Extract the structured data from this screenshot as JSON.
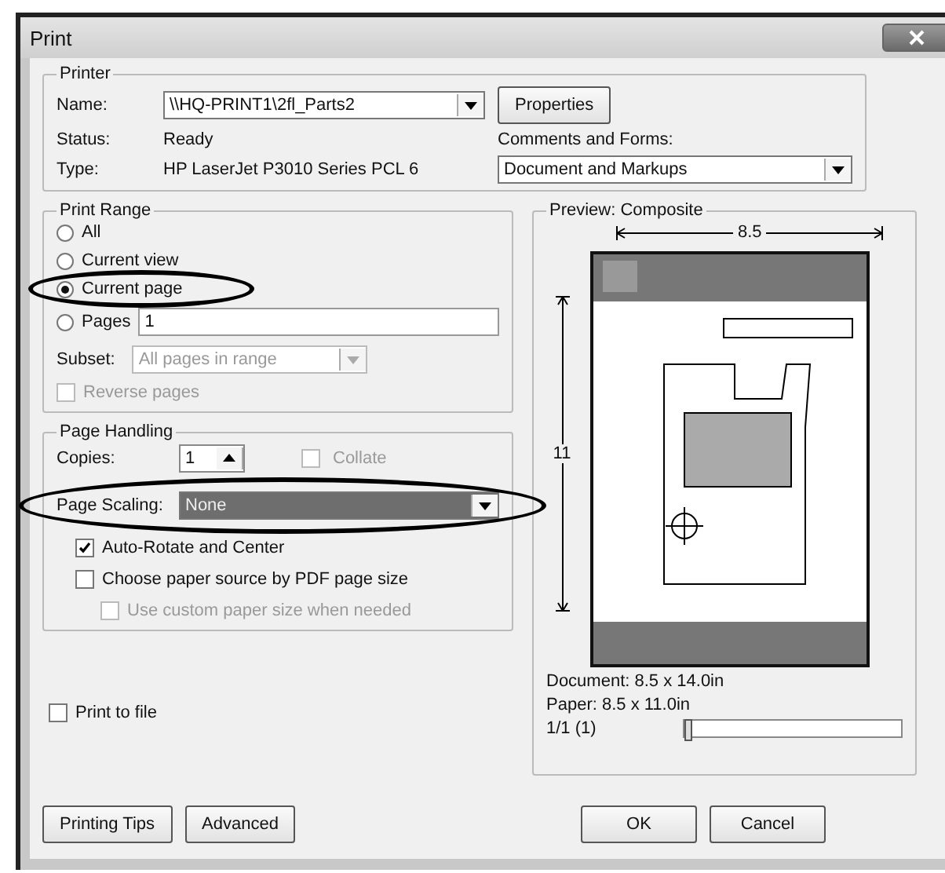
{
  "window": {
    "title": "Print"
  },
  "printer": {
    "group_label": "Printer",
    "name_label": "Name:",
    "name_value": "\\\\HQ-PRINT1\\2fl_Parts2",
    "properties_button": "Properties",
    "status_label": "Status:",
    "status_value": "Ready",
    "type_label": "Type:",
    "type_value": "HP LaserJet P3010 Series PCL 6",
    "comments_label": "Comments and Forms:",
    "comments_value": "Document and Markups"
  },
  "print_range": {
    "group_label": "Print Range",
    "options": [
      {
        "label": "All",
        "selected": false
      },
      {
        "label": "Current view",
        "selected": false
      },
      {
        "label": "Current page",
        "selected": true
      },
      {
        "label": "Pages",
        "selected": false,
        "value": "1"
      }
    ],
    "subset_label": "Subset:",
    "subset_value": "All pages in range",
    "subset_disabled": true,
    "reverse_pages": {
      "label": "Reverse pages",
      "checked": false,
      "disabled": true
    }
  },
  "page_handling": {
    "group_label": "Page Handling",
    "copies_label": "Copies:",
    "copies_value": "1",
    "collate": {
      "label": "Collate",
      "checked": false,
      "disabled": true
    },
    "scaling_label": "Page Scaling:",
    "scaling_value": "None",
    "scaling_highlighted": true,
    "options": [
      {
        "label": "Auto-Rotate and Center",
        "checked": true,
        "disabled": false
      },
      {
        "label": "Choose paper source by PDF page size",
        "checked": false,
        "disabled": false,
        "children": [
          {
            "label": "Use custom paper size when needed",
            "checked": false,
            "disabled": true
          }
        ]
      }
    ]
  },
  "print_to_file": {
    "label": "Print to file",
    "checked": false
  },
  "preview": {
    "group_label": "Preview: Composite",
    "width_label": "8.5",
    "height_label": "11",
    "document": "Document: 8.5 x 14.0in",
    "paper": "Paper: 8.5 x 11.0in",
    "page_counter": "1/1 (1)",
    "page_slider": {
      "level": 0
    }
  },
  "buttons": [
    {
      "label": "Printing Tips",
      "kind": "left"
    },
    {
      "label": "Advanced",
      "kind": "left"
    },
    {
      "label": "OK",
      "kind": "right"
    },
    {
      "label": "Cancel",
      "kind": "right"
    }
  ]
}
